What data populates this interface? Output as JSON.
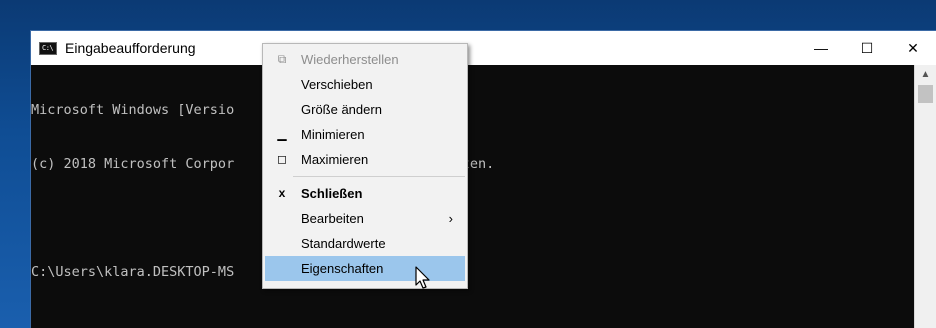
{
  "window": {
    "title": "Eingabeaufforderung",
    "icon_text": "C:\\",
    "buttons": {
      "minimize": "—",
      "maximize": "☐",
      "close": "✕"
    }
  },
  "console": {
    "lines": [
      "Microsoft Windows [Versio",
      "(c) 2018 Microsoft Corpor                       behalten.",
      "",
      "C:\\Users\\klara.DESKTOP-MS"
    ]
  },
  "context_menu": {
    "items": [
      {
        "label": "Wiederherstellen",
        "glyph": "⧉",
        "state": "disabled"
      },
      {
        "label": "Verschieben",
        "glyph": ""
      },
      {
        "label": "Größe ändern",
        "glyph": ""
      },
      {
        "label": "Minimieren",
        "glyph": "▁"
      },
      {
        "label": "Maximieren",
        "glyph": "◻"
      },
      {
        "label": "Schließen",
        "glyph": "x",
        "state": "bold"
      },
      {
        "label": "Bearbeiten",
        "glyph": "",
        "submenu_arrow": "›"
      },
      {
        "label": "Standardwerte",
        "glyph": ""
      },
      {
        "label": "Eigenschaften",
        "glyph": "",
        "state": "highlighted"
      }
    ]
  },
  "colors": {
    "desktop": "#0f4d94",
    "console_bg": "#0c0c0c",
    "console_text": "#c0c0c0",
    "menu_bg": "#f2f2f2",
    "menu_highlight": "#9bc6ec"
  }
}
